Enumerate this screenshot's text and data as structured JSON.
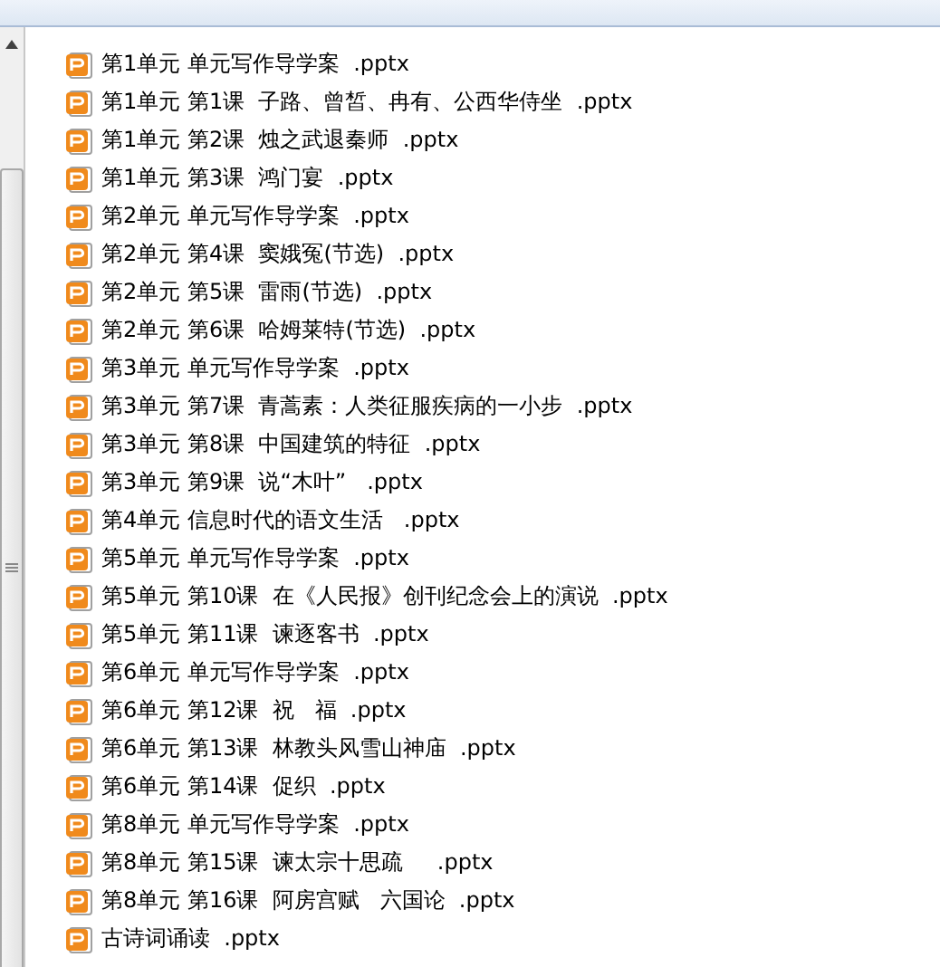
{
  "files": [
    {
      "name": "第1单元 单元写作导学案  .pptx"
    },
    {
      "name": "第1单元 第1课  子路、曾皙、冉有、公西华侍坐  .pptx"
    },
    {
      "name": "第1单元 第2课  烛之武退秦师  .pptx"
    },
    {
      "name": "第1单元 第3课  鸿门宴  .pptx"
    },
    {
      "name": "第2单元 单元写作导学案  .pptx"
    },
    {
      "name": "第2单元 第4课  窦娥冤(节选)  .pptx"
    },
    {
      "name": "第2单元 第5课  雷雨(节选)  .pptx"
    },
    {
      "name": "第2单元 第6课  哈姆莱特(节选)  .pptx"
    },
    {
      "name": "第3单元 单元写作导学案  .pptx"
    },
    {
      "name": "第3单元 第7课  青蒿素：人类征服疾病的一小步  .pptx"
    },
    {
      "name": "第3单元 第8课  中国建筑的特征  .pptx"
    },
    {
      "name": "第3单元 第9课  说“木叶”   .pptx"
    },
    {
      "name": "第4单元 信息时代的语文生活   .pptx"
    },
    {
      "name": "第5单元 单元写作导学案  .pptx"
    },
    {
      "name": "第5单元 第10课  在《人民报》创刊纪念会上的演说  .pptx"
    },
    {
      "name": "第5单元 第11课  谏逐客书  .pptx"
    },
    {
      "name": "第6单元 单元写作导学案  .pptx"
    },
    {
      "name": "第6单元 第12课  祝   福  .pptx"
    },
    {
      "name": "第6单元 第13课  林教头风雪山神庙  .pptx"
    },
    {
      "name": "第6单元 第14课  促织  .pptx"
    },
    {
      "name": "第8单元 单元写作导学案  .pptx"
    },
    {
      "name": "第8单元 第15课  谏太宗十思疏     .pptx"
    },
    {
      "name": "第8单元 第16课  阿房宫赋   六国论  .pptx"
    },
    {
      "name": "古诗词诵读  .pptx"
    }
  ]
}
